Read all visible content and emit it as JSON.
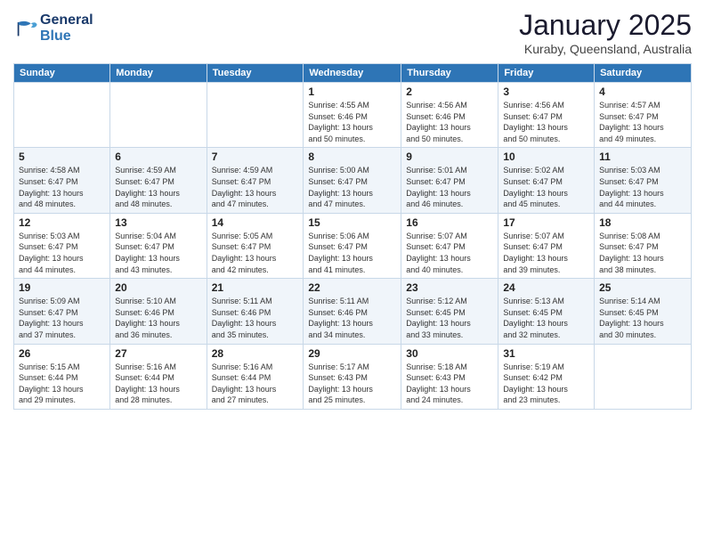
{
  "logo": {
    "line1": "General",
    "line2": "Blue"
  },
  "title": "January 2025",
  "location": "Kuraby, Queensland, Australia",
  "weekdays": [
    "Sunday",
    "Monday",
    "Tuesday",
    "Wednesday",
    "Thursday",
    "Friday",
    "Saturday"
  ],
  "weeks": [
    [
      {
        "day": "",
        "info": ""
      },
      {
        "day": "",
        "info": ""
      },
      {
        "day": "",
        "info": ""
      },
      {
        "day": "1",
        "info": "Sunrise: 4:55 AM\nSunset: 6:46 PM\nDaylight: 13 hours\nand 50 minutes."
      },
      {
        "day": "2",
        "info": "Sunrise: 4:56 AM\nSunset: 6:46 PM\nDaylight: 13 hours\nand 50 minutes."
      },
      {
        "day": "3",
        "info": "Sunrise: 4:56 AM\nSunset: 6:47 PM\nDaylight: 13 hours\nand 50 minutes."
      },
      {
        "day": "4",
        "info": "Sunrise: 4:57 AM\nSunset: 6:47 PM\nDaylight: 13 hours\nand 49 minutes."
      }
    ],
    [
      {
        "day": "5",
        "info": "Sunrise: 4:58 AM\nSunset: 6:47 PM\nDaylight: 13 hours\nand 48 minutes."
      },
      {
        "day": "6",
        "info": "Sunrise: 4:59 AM\nSunset: 6:47 PM\nDaylight: 13 hours\nand 48 minutes."
      },
      {
        "day": "7",
        "info": "Sunrise: 4:59 AM\nSunset: 6:47 PM\nDaylight: 13 hours\nand 47 minutes."
      },
      {
        "day": "8",
        "info": "Sunrise: 5:00 AM\nSunset: 6:47 PM\nDaylight: 13 hours\nand 47 minutes."
      },
      {
        "day": "9",
        "info": "Sunrise: 5:01 AM\nSunset: 6:47 PM\nDaylight: 13 hours\nand 46 minutes."
      },
      {
        "day": "10",
        "info": "Sunrise: 5:02 AM\nSunset: 6:47 PM\nDaylight: 13 hours\nand 45 minutes."
      },
      {
        "day": "11",
        "info": "Sunrise: 5:03 AM\nSunset: 6:47 PM\nDaylight: 13 hours\nand 44 minutes."
      }
    ],
    [
      {
        "day": "12",
        "info": "Sunrise: 5:03 AM\nSunset: 6:47 PM\nDaylight: 13 hours\nand 44 minutes."
      },
      {
        "day": "13",
        "info": "Sunrise: 5:04 AM\nSunset: 6:47 PM\nDaylight: 13 hours\nand 43 minutes."
      },
      {
        "day": "14",
        "info": "Sunrise: 5:05 AM\nSunset: 6:47 PM\nDaylight: 13 hours\nand 42 minutes."
      },
      {
        "day": "15",
        "info": "Sunrise: 5:06 AM\nSunset: 6:47 PM\nDaylight: 13 hours\nand 41 minutes."
      },
      {
        "day": "16",
        "info": "Sunrise: 5:07 AM\nSunset: 6:47 PM\nDaylight: 13 hours\nand 40 minutes."
      },
      {
        "day": "17",
        "info": "Sunrise: 5:07 AM\nSunset: 6:47 PM\nDaylight: 13 hours\nand 39 minutes."
      },
      {
        "day": "18",
        "info": "Sunrise: 5:08 AM\nSunset: 6:47 PM\nDaylight: 13 hours\nand 38 minutes."
      }
    ],
    [
      {
        "day": "19",
        "info": "Sunrise: 5:09 AM\nSunset: 6:47 PM\nDaylight: 13 hours\nand 37 minutes."
      },
      {
        "day": "20",
        "info": "Sunrise: 5:10 AM\nSunset: 6:46 PM\nDaylight: 13 hours\nand 36 minutes."
      },
      {
        "day": "21",
        "info": "Sunrise: 5:11 AM\nSunset: 6:46 PM\nDaylight: 13 hours\nand 35 minutes."
      },
      {
        "day": "22",
        "info": "Sunrise: 5:11 AM\nSunset: 6:46 PM\nDaylight: 13 hours\nand 34 minutes."
      },
      {
        "day": "23",
        "info": "Sunrise: 5:12 AM\nSunset: 6:45 PM\nDaylight: 13 hours\nand 33 minutes."
      },
      {
        "day": "24",
        "info": "Sunrise: 5:13 AM\nSunset: 6:45 PM\nDaylight: 13 hours\nand 32 minutes."
      },
      {
        "day": "25",
        "info": "Sunrise: 5:14 AM\nSunset: 6:45 PM\nDaylight: 13 hours\nand 30 minutes."
      }
    ],
    [
      {
        "day": "26",
        "info": "Sunrise: 5:15 AM\nSunset: 6:44 PM\nDaylight: 13 hours\nand 29 minutes."
      },
      {
        "day": "27",
        "info": "Sunrise: 5:16 AM\nSunset: 6:44 PM\nDaylight: 13 hours\nand 28 minutes."
      },
      {
        "day": "28",
        "info": "Sunrise: 5:16 AM\nSunset: 6:44 PM\nDaylight: 13 hours\nand 27 minutes."
      },
      {
        "day": "29",
        "info": "Sunrise: 5:17 AM\nSunset: 6:43 PM\nDaylight: 13 hours\nand 25 minutes."
      },
      {
        "day": "30",
        "info": "Sunrise: 5:18 AM\nSunset: 6:43 PM\nDaylight: 13 hours\nand 24 minutes."
      },
      {
        "day": "31",
        "info": "Sunrise: 5:19 AM\nSunset: 6:42 PM\nDaylight: 13 hours\nand 23 minutes."
      },
      {
        "day": "",
        "info": ""
      }
    ]
  ]
}
